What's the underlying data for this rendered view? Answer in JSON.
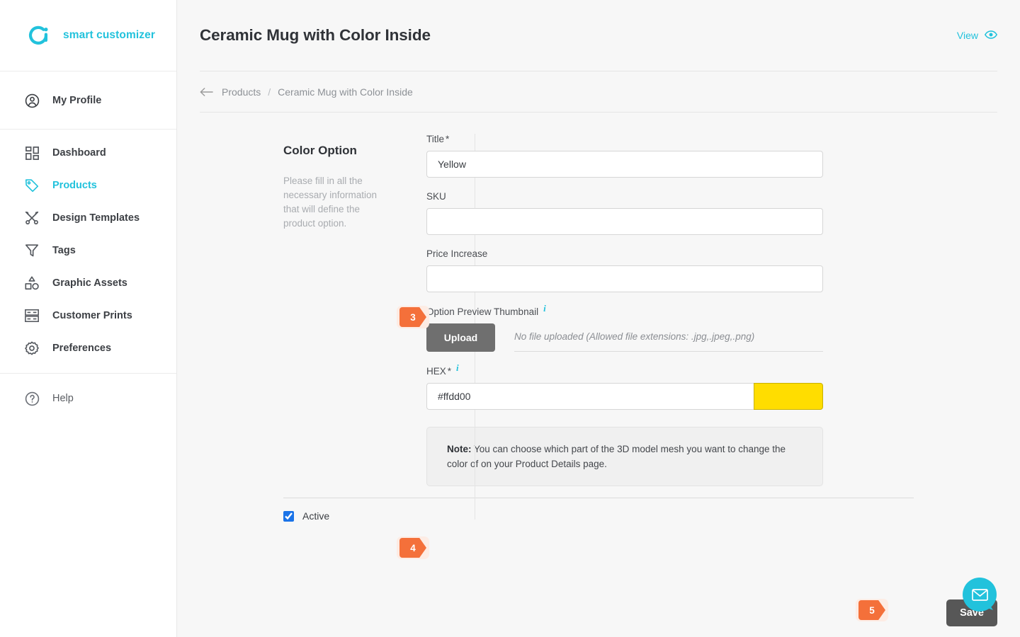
{
  "brand": {
    "name": "smart customizer",
    "logo_icon": "smart-customizer-logo",
    "color": "#22c2dc"
  },
  "sidebar": {
    "profile": {
      "label": "My Profile",
      "icon": "user-circle-icon"
    },
    "items": [
      {
        "label": "Dashboard",
        "icon": "dashboard-grid-icon",
        "active": false
      },
      {
        "label": "Products",
        "icon": "tag-icon",
        "active": true
      },
      {
        "label": "Design Templates",
        "icon": "design-templates-icon",
        "active": false
      },
      {
        "label": "Tags",
        "icon": "filter-funnel-icon",
        "active": false
      },
      {
        "label": "Graphic Assets",
        "icon": "shapes-icon",
        "active": false
      },
      {
        "label": "Customer Prints",
        "icon": "customer-prints-icon",
        "active": false
      },
      {
        "label": "Preferences",
        "icon": "gear-icon",
        "active": false
      }
    ],
    "help": {
      "label": "Help",
      "icon": "question-circle-icon"
    }
  },
  "header": {
    "title": "Ceramic Mug with Color Inside",
    "view_label": "View",
    "view_icon": "eye-icon"
  },
  "breadcrumb": {
    "back_icon": "arrow-left-icon",
    "parent": "Products",
    "separator": "/",
    "current": "Ceramic Mug with Color Inside"
  },
  "panel": {
    "title": "Color Option",
    "description": "Please fill in all the necessary information that will define the product option."
  },
  "form": {
    "title_field": {
      "label": "Title",
      "required": "*",
      "value": "Yellow",
      "placeholder": ""
    },
    "sku_field": {
      "label": "SKU",
      "value": "",
      "placeholder": ""
    },
    "price_field": {
      "label": "Price Increase",
      "value": "",
      "placeholder": ""
    },
    "thumbnail_field": {
      "label": "Option Preview Thumbnail",
      "info_icon": "info-icon",
      "upload_label": "Upload",
      "status": "No file uploaded (Allowed file extensions: .jpg,.jpeg,.png)"
    },
    "hex_field": {
      "label": "HEX",
      "required": "*",
      "info_icon": "info-icon",
      "value": "#ffdd00",
      "swatch_color": "#ffdd00"
    },
    "note": {
      "prefix": "Note:",
      "text": " You can choose which part of the 3D model mesh you want to change the color of on your Product Details page."
    }
  },
  "footer": {
    "active_label": "Active",
    "active_checked": true,
    "save_label": "Save"
  },
  "badges": {
    "step3": "3",
    "step4": "4",
    "step5": "5",
    "color": "#f4703a",
    "halo": "#fdece4"
  },
  "chat": {
    "icon": "envelope-chat-icon",
    "color": "#22c2dc"
  }
}
